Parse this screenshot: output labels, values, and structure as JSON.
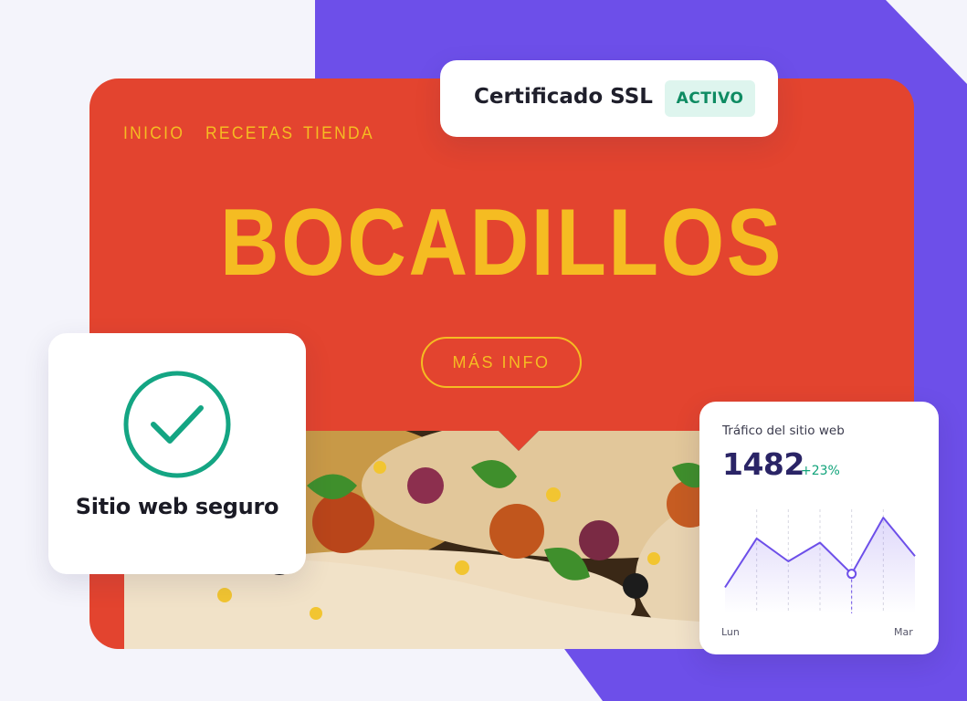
{
  "nav": {
    "items": [
      "INICIO",
      "RECETAS",
      "TIENDA"
    ]
  },
  "hero": {
    "title": "BOCADILLOS",
    "cta_label": "MÁS INFO"
  },
  "ssl": {
    "label": "Certificado SSL",
    "status": "ACTIVO"
  },
  "secure": {
    "label": "Sitio web seguro",
    "icon": "check-circle-icon"
  },
  "traffic": {
    "title": "Tráfico del sitio web",
    "value": "1482",
    "delta": "+23%",
    "x_start": "Lun",
    "x_end": "Mar"
  },
  "colors": {
    "brand_red": "#e3442f",
    "brand_yellow": "#f5bc22",
    "purple": "#6d4fe9",
    "success": "#11a37a"
  },
  "chart_data": {
    "type": "line",
    "x": [
      "Lun",
      "",
      "",
      "",
      "",
      "",
      "Mar"
    ],
    "values": [
      0.25,
      0.72,
      0.5,
      0.68,
      0.38,
      0.92,
      0.55
    ],
    "highlight_index": 4
  }
}
